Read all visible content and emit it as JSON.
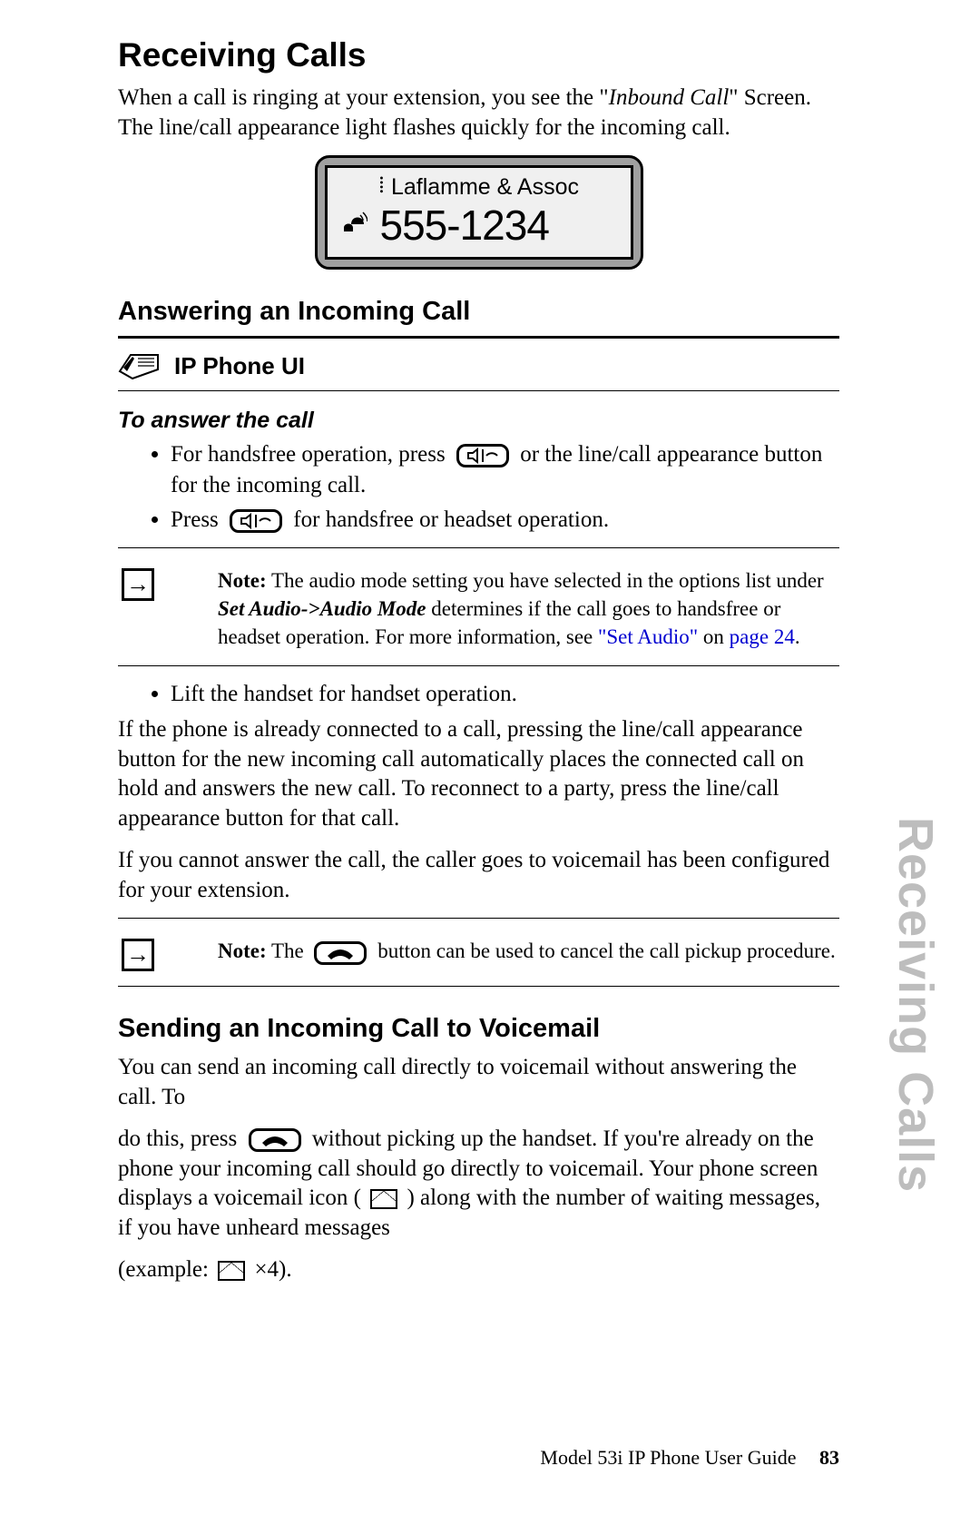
{
  "title": "Receiving Calls",
  "intro_a": "When a call is ringing at your extension, you see the \"",
  "intro_em": "Inbound Call",
  "intro_b": "\" Screen. The line/call appearance light flashes quickly for the incoming call.",
  "lcd": {
    "caller": "Laflamme & Assoc",
    "number": "555-1234"
  },
  "answer_heading": "Answering an Incoming Call",
  "ip_ui_label": "IP Phone UI",
  "to_answer": "To answer the call",
  "bullet1_a": "For handsfree operation, press ",
  "bullet1_b": " or the line/call appearance button for the incoming call.",
  "bullet2_a": "Press ",
  "bullet2_b": " for handsfree or headset operation.",
  "note1_label": "Note:",
  "note1_a": " The audio mode setting you have selected in the options list under ",
  "note1_set": "Set Audio->Audio Mode",
  "note1_b": " determines if the call goes to handsfree or headset operation. For more information, see ",
  "note1_link": "\"Set Audio\"",
  "note1_on": " on ",
  "note1_page": "page 24",
  "note1_end": ".",
  "bullet3": "Lift the handset for handset operation.",
  "para_hold": "If the phone is already connected to a call, pressing the line/call appearance button for the new incoming call automatically places the connected call on hold and answers the new call. To reconnect to a party, press the line/call appearance button for that call.",
  "para_vm": "If you cannot answer the call, the caller goes to voicemail has been configured for your extension.",
  "note2_label": "Note:",
  "note2_a": " The ",
  "note2_b": " button can be used to cancel the call pickup procedure.",
  "send_vm_heading": "Sending an Incoming Call to Voicemail",
  "send_vm_p1": "You can send an incoming call directly to voicemail without answering the call. To",
  "send_vm_p2a": "do this, press ",
  "send_vm_p2b": " without picking up the handset. If you're already on the phone your incoming call should go directly to voicemail. Your phone screen displays a voicemail icon ( ",
  "send_vm_p2c": " ) along with the number of waiting messages, if you have unheard messages",
  "example_a": "(example: ",
  "example_b": " ×4).",
  "side_title": "Receiving Calls",
  "footer_text": "Model 53i IP Phone User Guide",
  "footer_page": "83"
}
